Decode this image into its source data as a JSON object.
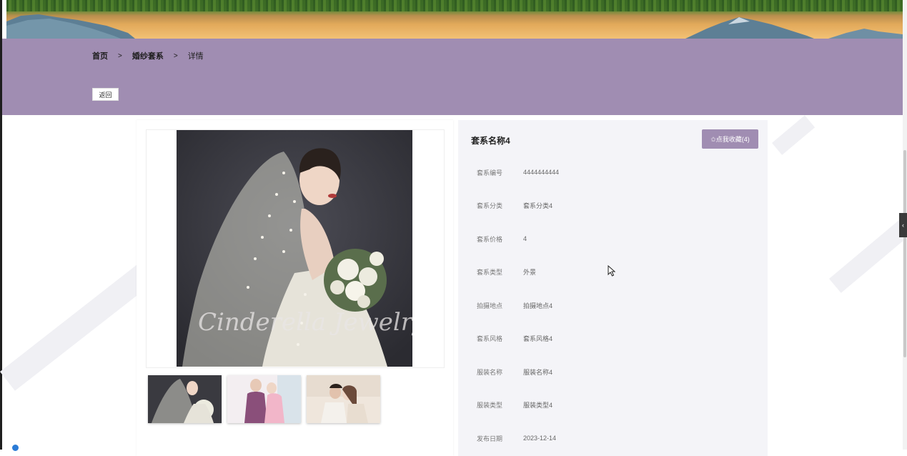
{
  "breadcrumb": {
    "home": "首页",
    "sep1": ">",
    "category": "婚纱套系",
    "sep2": ">",
    "current": "详情"
  },
  "back_button": "返回",
  "product": {
    "title": "套系名称4",
    "favorite_label": "✩点我收藏(4)",
    "fields": [
      {
        "label": "套系编号",
        "value": "4444444444"
      },
      {
        "label": "套系分类",
        "value": "套系分类4"
      },
      {
        "label": "套系价格",
        "value": "4"
      },
      {
        "label": "套系类型",
        "value": "外景"
      },
      {
        "label": "拍摄地点",
        "value": "拍摄地点4"
      },
      {
        "label": "套系风格",
        "value": "套系风格4"
      },
      {
        "label": "服装名称",
        "value": "服装名称4"
      },
      {
        "label": "服装类型",
        "value": "服装类型4"
      },
      {
        "label": "发布日期",
        "value": "2023-12-14"
      }
    ]
  },
  "gallery": {
    "watermark": "Cinderella Jewelry"
  },
  "colors": {
    "accent": "#a08db2",
    "panel": "#f4f4f8"
  },
  "side_tab_icon": "chevron-left-icon"
}
